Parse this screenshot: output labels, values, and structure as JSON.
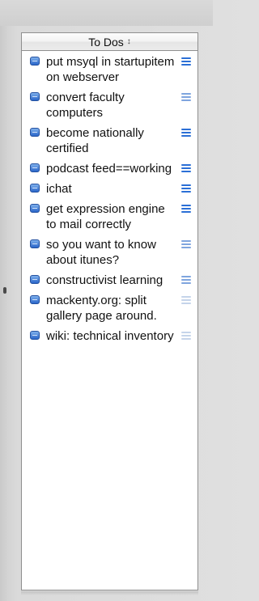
{
  "panel": {
    "header_label": "To Dos",
    "sort_icon": "↕"
  },
  "colors": {
    "priority_high": "#2b6fd6",
    "priority_medium": "#7fa5de",
    "priority_low": "#c5d4ea"
  },
  "todos": [
    {
      "text": "put msyql in startupitem on webserver",
      "priority": "high"
    },
    {
      "text": "convert faculty computers",
      "priority": "medium"
    },
    {
      "text": "become nationally certified",
      "priority": "high"
    },
    {
      "text": "podcast feed==working",
      "priority": "high"
    },
    {
      "text": "ichat",
      "priority": "high"
    },
    {
      "text": "get expression engine to mail correctly",
      "priority": "high"
    },
    {
      "text": "so you want to know about itunes?",
      "priority": "medium"
    },
    {
      "text": "constructivist learning",
      "priority": "medium"
    },
    {
      "text": "mackenty.org: split gallery page around.",
      "priority": "low"
    },
    {
      "text": "wiki: technical inventory",
      "priority": "low"
    }
  ]
}
